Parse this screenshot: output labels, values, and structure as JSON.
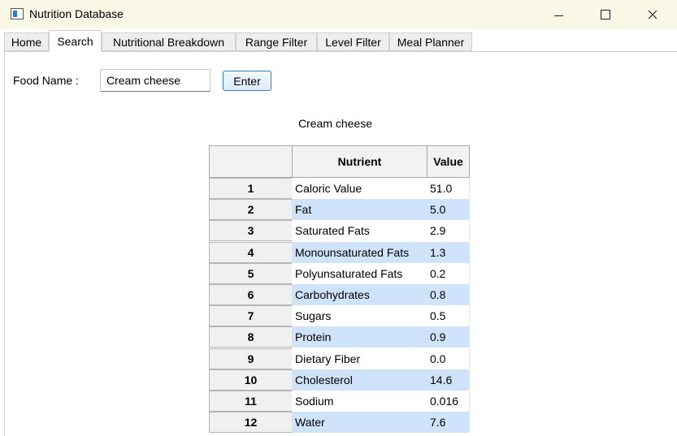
{
  "window": {
    "title": "Nutrition Database"
  },
  "tabs": [
    {
      "label": "Home"
    },
    {
      "label": "Search"
    },
    {
      "label": "Nutritional Breakdown"
    },
    {
      "label": "Range Filter"
    },
    {
      "label": "Level Filter"
    },
    {
      "label": "Meal Planner"
    }
  ],
  "search": {
    "label": "Food Name :",
    "input_value": "Cream cheese",
    "enter_label": "Enter",
    "result_title": "Cream cheese"
  },
  "table": {
    "headers": [
      "",
      "Nutrient",
      "Value"
    ],
    "rows": [
      {
        "index": "1",
        "nutrient": "Caloric Value",
        "value": "51.0"
      },
      {
        "index": "2",
        "nutrient": "Fat",
        "value": "5.0"
      },
      {
        "index": "3",
        "nutrient": "Saturated Fats",
        "value": "2.9"
      },
      {
        "index": "4",
        "nutrient": "Monounsaturated Fats",
        "value": "1.3"
      },
      {
        "index": "5",
        "nutrient": "Polyunsaturated Fats",
        "value": "0.2"
      },
      {
        "index": "6",
        "nutrient": "Carbohydrates",
        "value": "0.8"
      },
      {
        "index": "7",
        "nutrient": "Sugars",
        "value": "0.5"
      },
      {
        "index": "8",
        "nutrient": "Protein",
        "value": "0.9"
      },
      {
        "index": "9",
        "nutrient": "Dietary Fiber",
        "value": "0.0"
      },
      {
        "index": "10",
        "nutrient": "Cholesterol",
        "value": "14.6"
      },
      {
        "index": "11",
        "nutrient": "Sodium",
        "value": "0.016"
      },
      {
        "index": "12",
        "nutrient": "Water",
        "value": "7.6"
      }
    ]
  },
  "colors": {
    "titlebar": "#f9f8e6",
    "row_highlight": "#cfe4fb",
    "button_border": "#3c7fb1"
  },
  "icons": {
    "app": "window-app-icon",
    "minimize": "minimize-icon",
    "maximize": "maximize-icon",
    "close": "close-icon"
  }
}
